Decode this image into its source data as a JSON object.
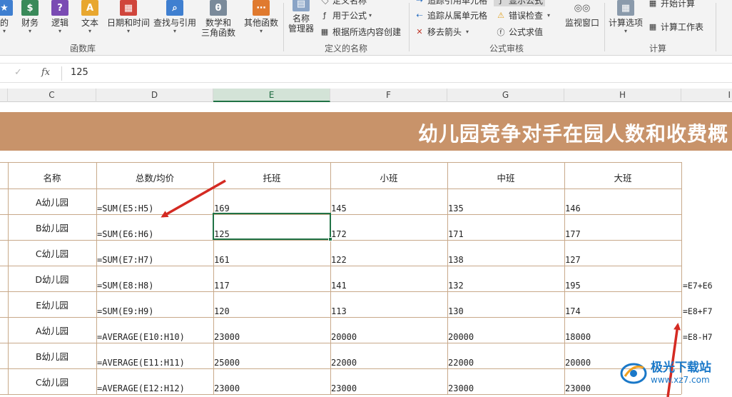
{
  "ribbon": {
    "buttons": [
      {
        "id": "fn-used",
        "label": "的",
        "color": "#3f7fd0"
      },
      {
        "id": "fn-financial",
        "label": "财务",
        "color": "#3a8a5a"
      },
      {
        "id": "fn-logical",
        "label": "逻辑",
        "color": "#7a4bb3"
      },
      {
        "id": "fn-text",
        "label": "文本",
        "color": "#e8a72f"
      },
      {
        "id": "fn-datetime",
        "label": "日期和时间",
        "color": "#d0453c"
      },
      {
        "id": "fn-lookup",
        "label": "查找与引用",
        "color": "#3f7fd0"
      },
      {
        "id": "fn-math",
        "label": "数学和",
        "label2": "三角函数",
        "color": "#7a8a9a"
      },
      {
        "id": "fn-more",
        "label": "其他函数",
        "color": "#e07a2f"
      }
    ],
    "name_manager": {
      "label": "名称",
      "label2": "管理器"
    },
    "defined_names": {
      "define_name": "定义名称",
      "use_in_formula": "用于公式",
      "create_from_selection": "根据所选内容创建"
    },
    "formula_auditing": {
      "trace_precedents": "追踪引用单元格",
      "trace_dependents": "追踪从属单元格",
      "remove_arrows": "移去箭头",
      "show_formulas": "显示公式",
      "error_checking": "错误检查",
      "evaluate_formula": "公式求值"
    },
    "watch_window": "监视窗口",
    "calc_options": "计算选项",
    "calc_now": "开始计算",
    "calc_sheet": "计算工作表",
    "groups": {
      "function_library": "函数库",
      "defined_names": "定义的名称",
      "formula_auditing": "公式审核",
      "calculation": "计算"
    }
  },
  "formula_bar": {
    "cancel_icon": "✓",
    "fx_icon": "fx",
    "value": "125"
  },
  "columns": [
    "C",
    "D",
    "E",
    "F",
    "G",
    "H",
    "I"
  ],
  "selected_column": "E",
  "sheet_title": "幼儿园竞争对手在园人数和收费概",
  "table": {
    "headers": [
      "名称",
      "总数/均价",
      "托班",
      "小班",
      "中班",
      "大班"
    ],
    "rows": [
      {
        "name": "A幼儿园",
        "formula": "=SUM(E5:H5)",
        "v": [
          "169",
          "145",
          "135",
          "146"
        ],
        "note": ""
      },
      {
        "name": "B幼儿园",
        "formula": "=SUM(E6:H6)",
        "v": [
          "125",
          "172",
          "171",
          "177"
        ],
        "note": ""
      },
      {
        "name": "C幼儿园",
        "formula": "=SUM(E7:H7)",
        "v": [
          "161",
          "122",
          "138",
          "127"
        ],
        "note": ""
      },
      {
        "name": "D幼儿园",
        "formula": "=SUM(E8:H8)",
        "v": [
          "117",
          "141",
          "132",
          "195"
        ],
        "note": "=E7+E6"
      },
      {
        "name": "E幼儿园",
        "formula": "=SUM(E9:H9)",
        "v": [
          "120",
          "113",
          "130",
          "174"
        ],
        "note": "=E8+F7"
      },
      {
        "name": "A幼儿园",
        "formula": "=AVERAGE(E10:H10)",
        "v": [
          "23000",
          "20000",
          "20000",
          "18000"
        ],
        "note": "=E8-H7"
      },
      {
        "name": "B幼儿园",
        "formula": "=AVERAGE(E11:H11)",
        "v": [
          "25000",
          "22000",
          "22000",
          "20000"
        ],
        "note": ""
      },
      {
        "name": "C幼儿园",
        "formula": "=AVERAGE(E12:H12)",
        "v": [
          "23000",
          "23000",
          "23000",
          "23000"
        ],
        "note": ""
      }
    ]
  },
  "watermark": {
    "text": "极光下载站",
    "url": "www.xz7.com"
  },
  "colors": {
    "title_band": "#c8936a",
    "grid_line": "#c8a98a",
    "active_border": "#217346",
    "arrow": "#d42a22"
  }
}
